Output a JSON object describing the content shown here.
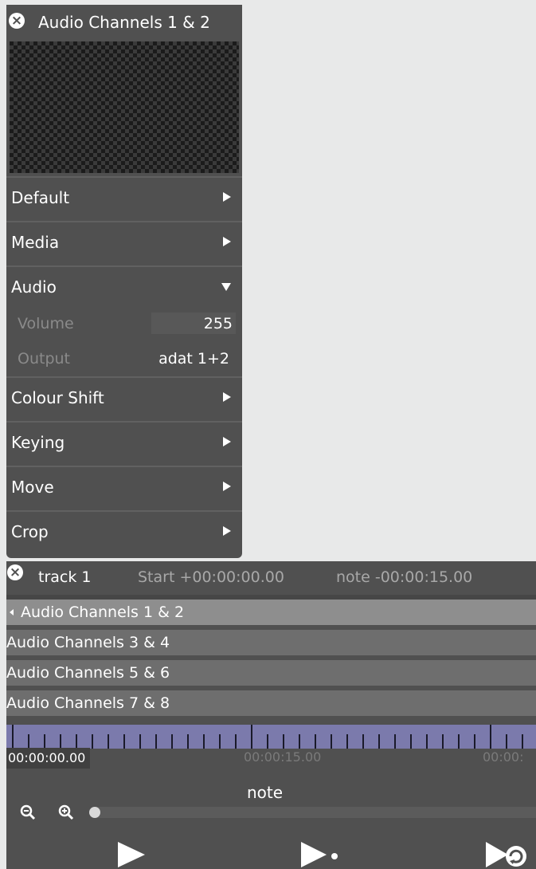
{
  "panel": {
    "title": "Audio Channels 1 & 2",
    "close_icon": "close-circle-icon",
    "sections": [
      {
        "label": "Default",
        "state": "collapsed"
      },
      {
        "label": "Media",
        "state": "collapsed"
      },
      {
        "label": "Audio",
        "state": "expanded"
      },
      {
        "label": "Colour Shift",
        "state": "collapsed"
      },
      {
        "label": "Keying",
        "state": "collapsed"
      },
      {
        "label": "Move",
        "state": "collapsed"
      },
      {
        "label": "Crop",
        "state": "collapsed"
      }
    ],
    "audio": {
      "volume_label": "Volume",
      "volume_value": "255",
      "output_label": "Output",
      "output_value": "adat 1+2"
    }
  },
  "track": {
    "name": "track 1",
    "start": "Start +00:00:00.00",
    "note": "note -00:00:15.00",
    "clips": [
      {
        "label": "Audio Channels 1 & 2",
        "selected": true
      },
      {
        "label": "Audio Channels 3 & 4",
        "selected": false
      },
      {
        "label": "Audio Channels 5 & 6",
        "selected": false
      },
      {
        "label": "Audio Channels 7 & 8",
        "selected": false
      }
    ],
    "timeline": {
      "current_time": "00:00:00.00",
      "marker_15": "00:00:15.00",
      "marker_30": "00:00:"
    },
    "note_label": "note",
    "controls": {
      "zoom_out_icon": "zoom-out-icon",
      "zoom_in_icon": "zoom-in-icon",
      "play_icon": "play-icon",
      "play_next_icon": "play-next-icon",
      "loop_icon": "loop-play-icon"
    }
  },
  "colors": {
    "panel_bg": "#505050",
    "page_bg": "#e8e9e9",
    "ruler": "#7b7aac",
    "clip": "#6e6e6e",
    "clip_selected": "#8e8e8e"
  }
}
